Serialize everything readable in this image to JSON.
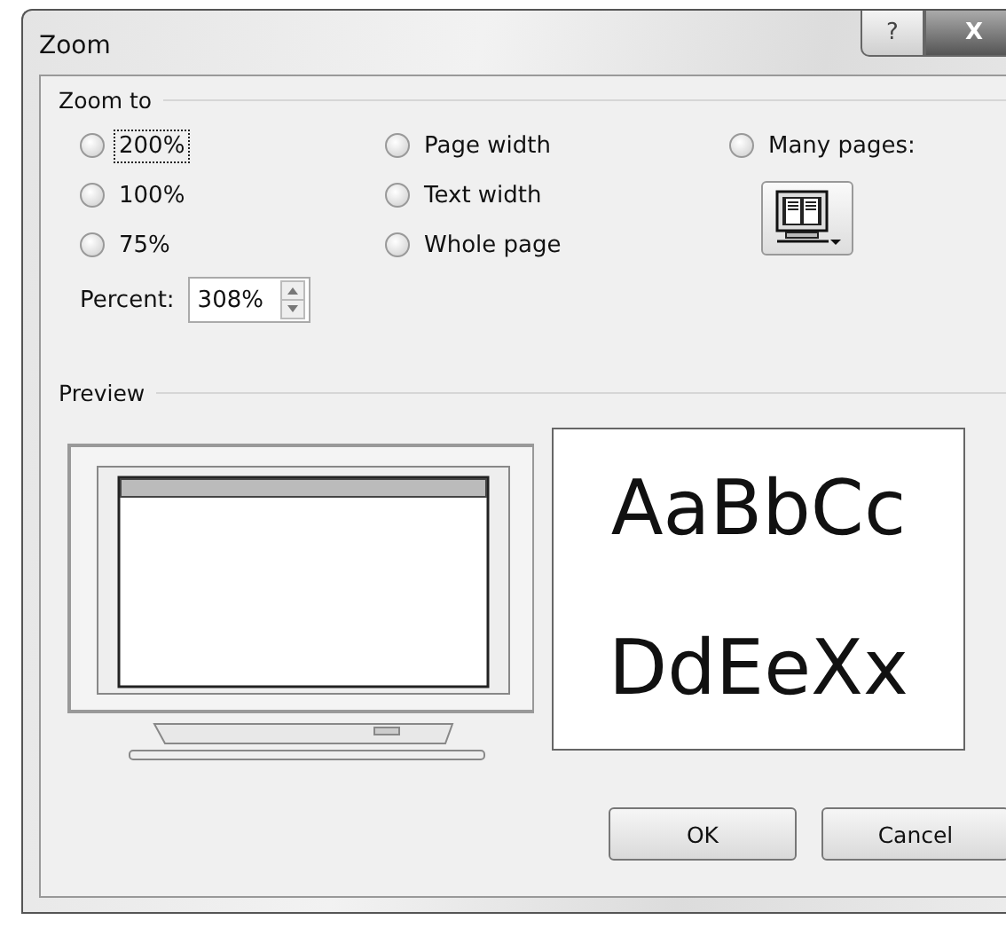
{
  "window": {
    "title": "Zoom",
    "help_glyph": "?",
    "close_glyph": "X"
  },
  "zoom_to": {
    "heading": "Zoom to",
    "options": [
      {
        "label": "200%",
        "selected": false,
        "focused": true
      },
      {
        "label": "Page width",
        "selected": false,
        "focused": false
      },
      {
        "label": "Many pages:",
        "selected": false,
        "focused": false
      },
      {
        "label": "100%",
        "selected": false,
        "focused": false
      },
      {
        "label": "Text width",
        "selected": false,
        "focused": false
      },
      {
        "label": "75%",
        "selected": false,
        "focused": false
      },
      {
        "label": "Whole page",
        "selected": false,
        "focused": false
      }
    ],
    "percent": {
      "label": "Percent:",
      "value": "308%"
    }
  },
  "preview": {
    "heading": "Preview",
    "sample_lines": [
      "AaBbCc",
      "DdEeXx"
    ]
  },
  "buttons": [
    "OK",
    "Cancel"
  ]
}
